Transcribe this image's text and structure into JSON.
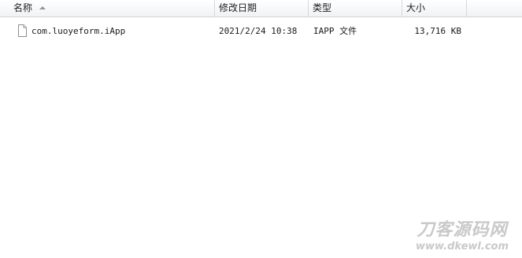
{
  "columns": {
    "name": "名称",
    "modified": "修改日期",
    "type": "类型",
    "size": "大小"
  },
  "sort": {
    "column": "name",
    "direction": "ascending"
  },
  "files": [
    {
      "name": "com.luoyeform.iApp",
      "modified": "2021/2/24 10:38",
      "type": "IAPP 文件",
      "size": "13,716 KB",
      "icon": "generic-file-icon"
    }
  ],
  "watermark": {
    "title": "刀客源码网",
    "url": "www.dkewl.com"
  }
}
